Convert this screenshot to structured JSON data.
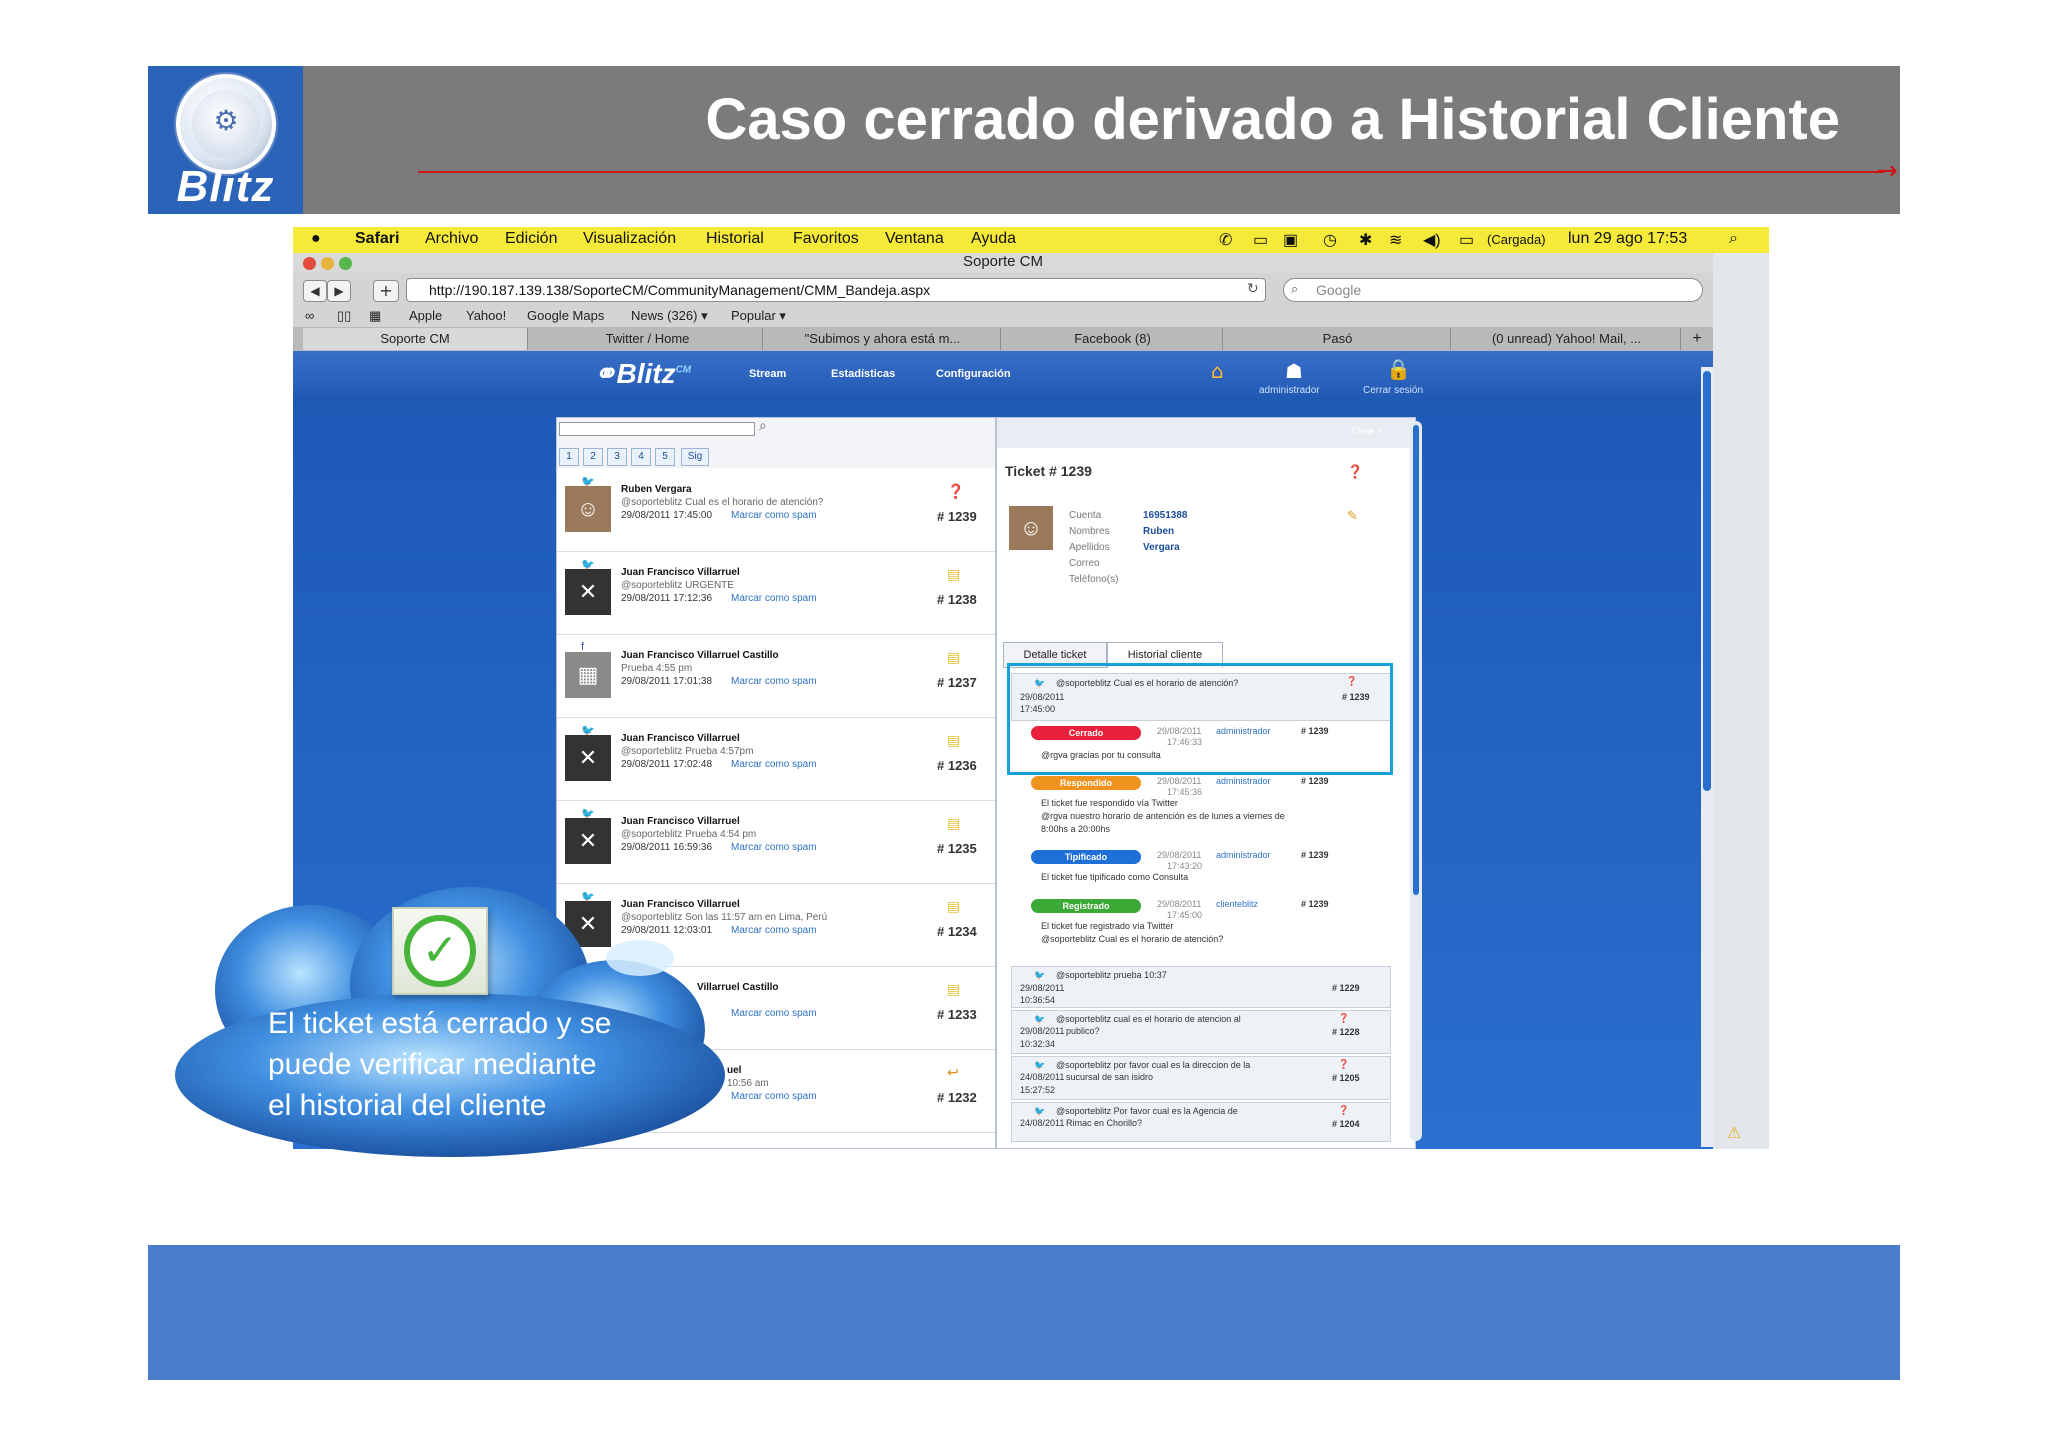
{
  "slide": {
    "title": "Caso cerrado derivado a Historial Cliente",
    "logo_text": "Blitz",
    "cloud_text": "El ticket está cerrado y se puede verificar mediante el historial del cliente",
    "colors": {
      "header": "#7b7b7b",
      "logo_bg": "#2a63b8",
      "footer": "#4a7ccc",
      "title_line": "#d01414"
    }
  },
  "mac_menu": {
    "items": [
      "Safari",
      "Archivo",
      "Edición",
      "Visualización",
      "Historial",
      "Favoritos",
      "Ventana",
      "Ayuda"
    ],
    "battery": "(Cargada)",
    "clock": "lun 29 ago  17:53"
  },
  "browser": {
    "window_title": "Soporte CM",
    "url": "http://190.187.139.138/SoporteCM/CommunityManagement/CMM_Bandeja.aspx",
    "search_placeholder": "Google",
    "bookmarks": [
      "Apple",
      "Yahoo!",
      "Google Maps",
      "News (326) ▾",
      "Popular ▾"
    ],
    "tabs": [
      "Soporte CM",
      "Twitter / Home",
      "\"Subimos y ahora está m...",
      "Facebook (8)",
      "Pasó",
      "(0 unread) Yahoo! Mail, ..."
    ]
  },
  "app": {
    "logo": "Blitz",
    "logo_sup": "CM",
    "nav": [
      "Stream",
      "Estadísticas",
      "Configuración"
    ],
    "user_label": "administrador",
    "logout_label": "Cerrar sesión",
    "pages": [
      "1",
      "2",
      "3",
      "4",
      "5",
      "Sig"
    ],
    "spam_label": "Marcar como spam",
    "tickets": [
      {
        "name": "Ruben Vergara",
        "msg": "@soporteblitz Cual es el horario de atención?",
        "date": "29/08/2011 17:45:00",
        "num": "# 1239"
      },
      {
        "name": "Juan Francisco Villarruel",
        "msg": "@soporteblitz URGENTE",
        "date": "29/08/2011 17:12:36",
        "num": "# 1238"
      },
      {
        "name": "Juan Francisco Villarruel Castillo",
        "msg": "Prueba 4:55 pm",
        "date": "29/08/2011 17:01:38",
        "num": "# 1237"
      },
      {
        "name": "Juan Francisco Villarruel",
        "msg": "@soporteblitz Prueba 4:57pm",
        "date": "29/08/2011 17:02:48",
        "num": "# 1236"
      },
      {
        "name": "Juan Francisco Villarruel",
        "msg": "@soporteblitz Prueba 4:54 pm",
        "date": "29/08/2011 16:59:36",
        "num": "# 1235"
      },
      {
        "name": "Juan Francisco Villarruel",
        "msg": "@soporteblitz Son las 11:57 am en Lima, Perú",
        "date": "29/08/2011 12:03:01",
        "num": "# 1234"
      },
      {
        "name": "Villarruel Castillo",
        "msg": "",
        "date": "",
        "num": "# 1233"
      },
      {
        "name": "uel",
        "msg": "10:56 am",
        "date": "",
        "num": "# 1232"
      }
    ],
    "detail": {
      "close_label": "Close ×",
      "ticket_title": "Ticket # 1239",
      "fields": [
        {
          "label": "Cuenta",
          "value": "16951388"
        },
        {
          "label": "Nombres",
          "value": "Ruben"
        },
        {
          "label": "Apellidos",
          "value": "Vergara"
        },
        {
          "label": "Correo",
          "value": ""
        },
        {
          "label": "Teléfono(s)",
          "value": ""
        }
      ],
      "tabs": [
        "Detalle ticket",
        "Historial cliente"
      ],
      "history_head": {
        "text": "@soporteblitz Cual es el horario de atención?",
        "date": "29/08/2011",
        "time": "17:45:00",
        "num": "# 1239"
      },
      "events": [
        {
          "status": "Cerrado",
          "color": "#e8203a",
          "date": "29/08/2011",
          "time": "17:46:33",
          "user": "administrador",
          "num": "# 1239",
          "lines": [
            "@rgva gracias por tu consulta"
          ]
        },
        {
          "status": "Respondido",
          "color": "#f0921e",
          "date": "29/08/2011",
          "time": "17:45:36",
          "user": "administrador",
          "num": "# 1239",
          "lines": [
            "El ticket fue respondido vía Twitter",
            "@rgva nuestro horario de antención es de lunes a viernes de",
            "8:00hs a 20:00hs"
          ]
        },
        {
          "status": "Tipificado",
          "color": "#1e6fd8",
          "date": "29/08/2011",
          "time": "17:43:20",
          "user": "administrador",
          "num": "# 1239",
          "lines": [
            "El ticket fue tipificado como Consulta"
          ]
        },
        {
          "status": "Registrado",
          "color": "#3aa935",
          "date": "29/08/2011",
          "time": "17:45:00",
          "user": "clienteblitz",
          "num": "# 1239",
          "lines": [
            "El ticket fue registrado vía Twitter",
            "@soporteblitz Cual es el horario de atención?"
          ]
        }
      ],
      "others": [
        {
          "text": "@soporteblitz prueba 10:37",
          "date": "29/08/2011",
          "time": "10:36:54",
          "num": "# 1229"
        },
        {
          "text": "@soporteblitz cual es el horario de atencion al",
          "text2": "publico?",
          "date": "29/08/2011",
          "time": "10:32:34",
          "num": "# 1228"
        },
        {
          "text": "@soporteblitz por favor cual es la direccion de la",
          "text2": "sucursal de san isidro",
          "date": "24/08/2011",
          "time": "15:27:52",
          "num": "# 1205"
        },
        {
          "text": "@soporteblitz Por favor cual es la Agencia de",
          "text2": "Rimac en Chorillo?",
          "date": "24/08/2011",
          "time": "",
          "num": "# 1204"
        }
      ]
    }
  }
}
